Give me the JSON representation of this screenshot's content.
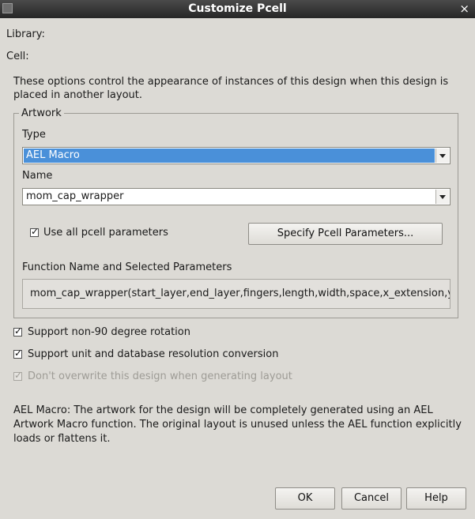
{
  "window": {
    "title": "Customize Pcell",
    "close_glyph": "×"
  },
  "library_label": "Library:",
  "cell_label": "Cell:",
  "intro": "These options control the appearance of instances of this design when this design is placed in another layout.",
  "artwork": {
    "group_label": "Artwork",
    "type_label": "Type",
    "type_value": "AEL Macro",
    "name_label": "Name",
    "name_value": "mom_cap_wrapper",
    "use_all_label": "Use all pcell parameters",
    "use_all_checked": true,
    "specify_button": "Specify Pcell Parameters...",
    "function_label": "Function Name and Selected Parameters",
    "function_value": "mom_cap_wrapper(start_layer,end_layer,fingers,length,width,space,x_extension,y_extension)"
  },
  "options": {
    "rotation_label": "Support non-90 degree rotation",
    "rotation_checked": true,
    "resolution_label": "Support unit and database resolution conversion",
    "resolution_checked": true,
    "overwrite_label": "Don't overwrite this design when generating layout",
    "overwrite_checked": true,
    "overwrite_disabled": true
  },
  "description": "AEL Macro: The artwork for the design will be completely generated using an AEL Artwork Macro function.  The original layout is unused unless the AEL function explicitly loads or flattens it.",
  "buttons": {
    "ok": "OK",
    "cancel": "Cancel",
    "help": "Help"
  },
  "icons": [
    "window-icon",
    "close-icon",
    "chevron-down-icon",
    "checkmark-icon"
  ]
}
